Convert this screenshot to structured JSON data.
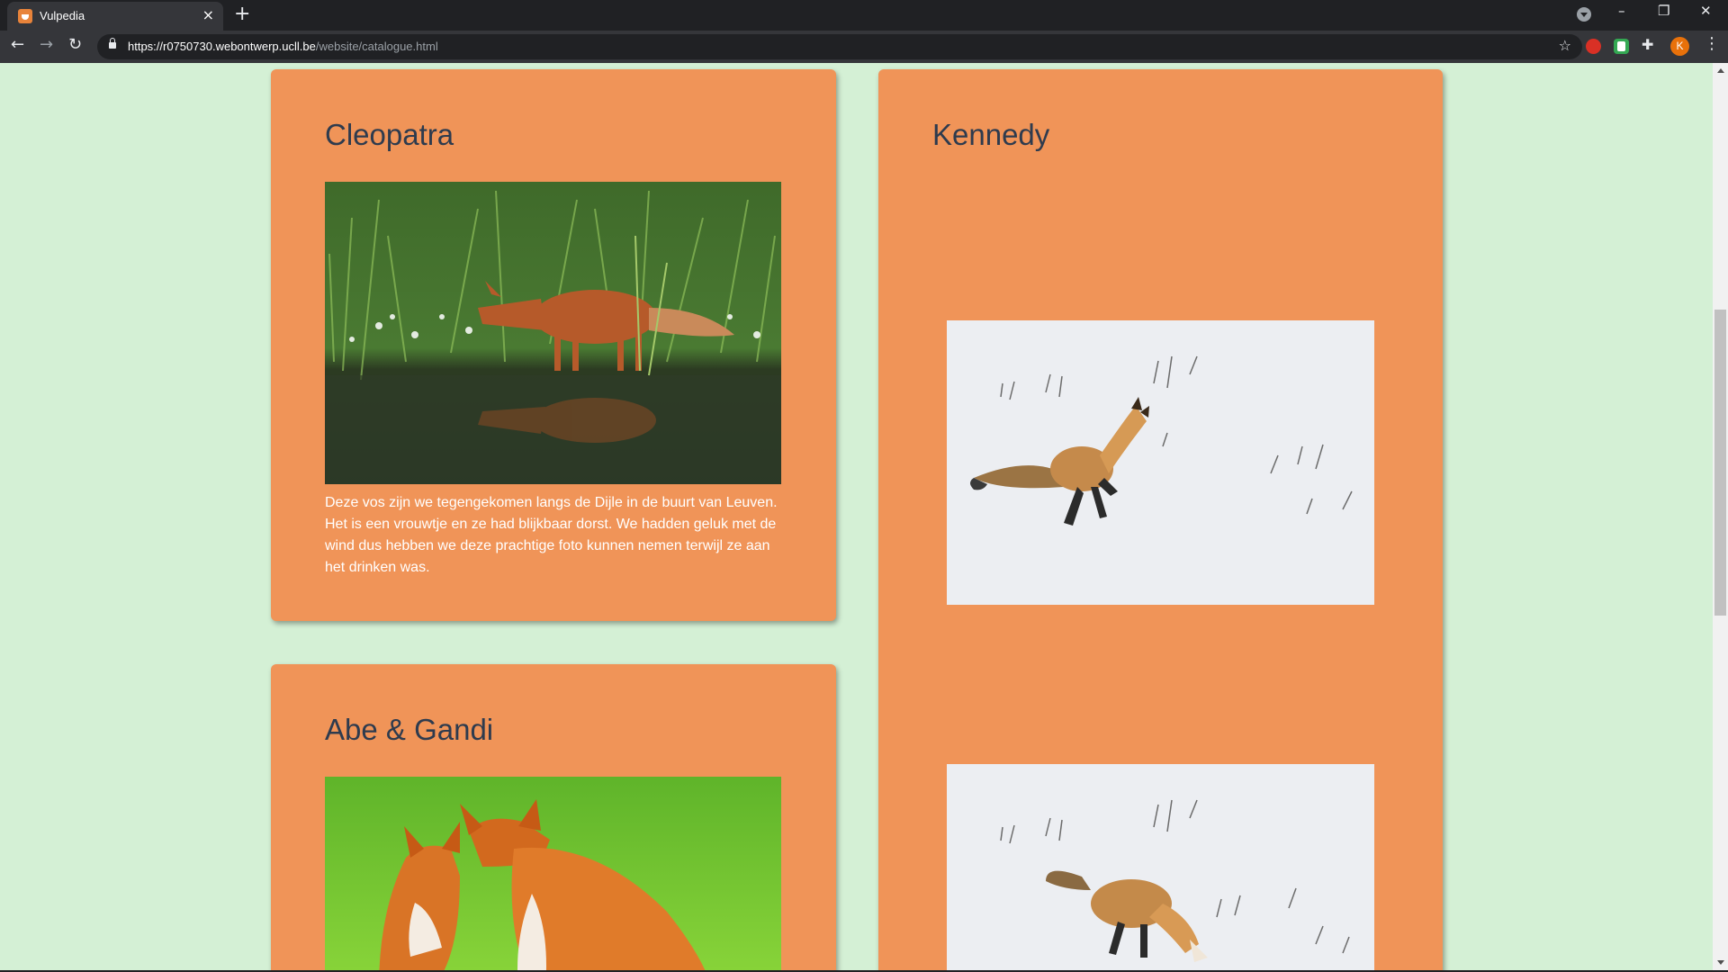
{
  "browser": {
    "tab_title": "Vulpedia",
    "tab_close": "×",
    "new_tab": "+",
    "url_host": "https://r0750730.webontwerp.ucll.be",
    "url_path": "/website/catalogue.html",
    "profile_initial": "K",
    "window_minimize": "–",
    "window_restore": "❐",
    "window_close": "✕",
    "icons": [
      "back-icon",
      "forward-icon",
      "reload-icon",
      "lock-icon",
      "star-icon",
      "extension-icon",
      "menu-icon"
    ]
  },
  "cards": [
    {
      "name": "Cleopatra",
      "description": "Deze vos zijn we tegengekomen langs de Dijle in de buurt van Leuven. Het is een vrouwtje en ze had blijkbaar dorst. We hadden geluk met de wind dus hebben we deze prachtige foto kunnen nemen terwijl ze aan het drinken was."
    },
    {
      "name": "Kennedy"
    },
    {
      "name": "Abe & Gandi"
    }
  ],
  "colors": {
    "page_background": "#d4f0d5",
    "card_background": "#f09458",
    "heading": "#2e3b4e",
    "text": "#ffffff"
  }
}
